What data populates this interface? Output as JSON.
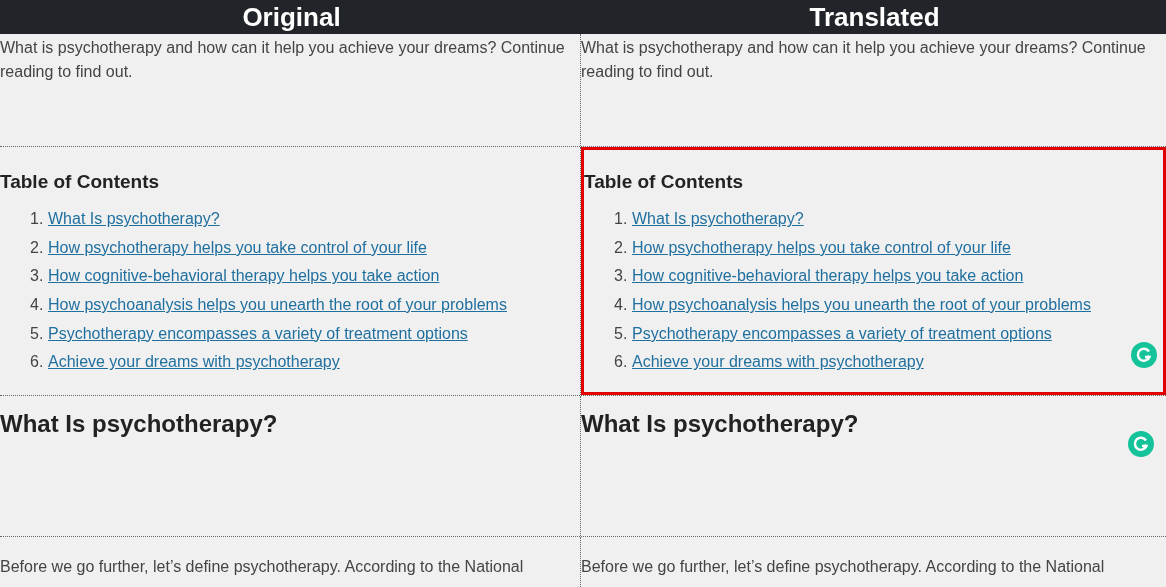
{
  "columns": [
    {
      "title": "Original"
    },
    {
      "title": "Translated"
    }
  ],
  "rows": [
    {
      "kind": "paragraph",
      "cells": [
        {
          "text": "What is psychotherapy and how can it help you achieve your dreams? Continue reading to find out.",
          "selected": false,
          "assistant_icon": false
        },
        {
          "text": "What is psychotherapy and how can it help you achieve your dreams? Continue reading to find out.",
          "selected": false,
          "assistant_icon": false
        }
      ]
    },
    {
      "kind": "toc",
      "cells": [
        {
          "title": "Table of Contents",
          "selected": false,
          "assistant_icon": false,
          "items": [
            {
              "number": "1.",
              "text": "What Is psychotherapy?"
            },
            {
              "number": "2.",
              "text": "How psychotherapy helps you take control of your life"
            },
            {
              "number": "3.",
              "text": "How cognitive-behavioral therapy helps you take action"
            },
            {
              "number": "4.",
              "text": "How psychoanalysis helps you unearth the root of your problems"
            },
            {
              "number": "5.",
              "text": "Psychotherapy encompasses a variety of treatment options"
            },
            {
              "number": "6.",
              "text": "Achieve your dreams with psychotherapy"
            }
          ]
        },
        {
          "title": "Table of Contents",
          "selected": true,
          "assistant_icon": true,
          "items": [
            {
              "number": "1.",
              "text": "What Is psychotherapy?"
            },
            {
              "number": "2.",
              "text": "How psychotherapy helps you take control of your life"
            },
            {
              "number": "3.",
              "text": "How cognitive-behavioral therapy helps you take action"
            },
            {
              "number": "4.",
              "text": "How psychoanalysis helps you unearth the root of your problems"
            },
            {
              "number": "5.",
              "text": "Psychotherapy encompasses a variety of treatment options"
            },
            {
              "number": "6.",
              "text": "Achieve your dreams with psychotherapy"
            }
          ]
        }
      ]
    },
    {
      "kind": "heading",
      "cells": [
        {
          "text": "What Is psychotherapy?",
          "selected": false,
          "assistant_icon": false
        },
        {
          "text": "What Is psychotherapy?",
          "selected": false,
          "assistant_icon": true
        }
      ]
    },
    {
      "kind": "paragraph",
      "cells": [
        {
          "text": "Before we go further, let’s define psychotherapy. According to the National",
          "selected": false,
          "assistant_icon": false
        },
        {
          "text": "Before we go further, let’s define psychotherapy. According to the National",
          "selected": false,
          "assistant_icon": false
        }
      ]
    }
  ]
}
